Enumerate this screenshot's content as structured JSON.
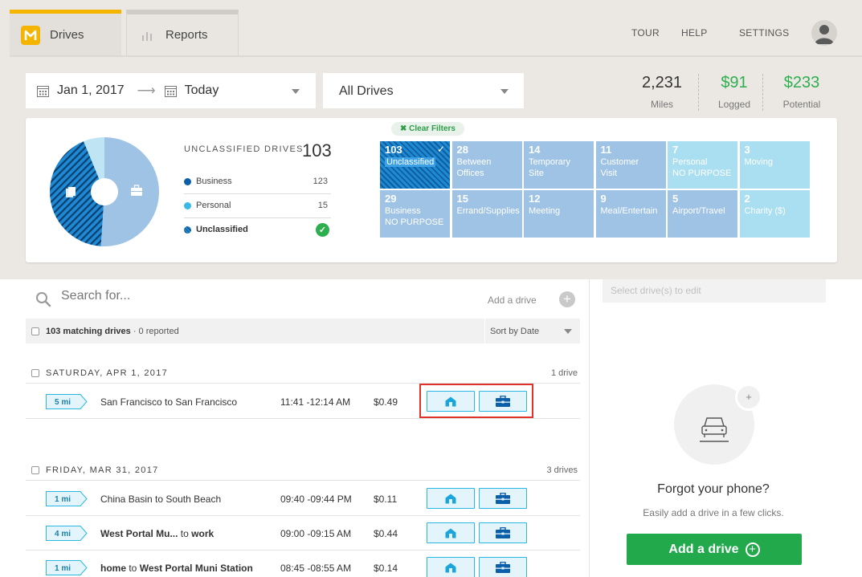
{
  "tabs": {
    "drives": "Drives",
    "reports": "Reports"
  },
  "nav": {
    "tour": "TOUR",
    "help": "HELP",
    "settings": "SETTINGS"
  },
  "filters": {
    "start_date": "Jan 1, 2017",
    "end_date": "Today",
    "drive_filter": "All Drives"
  },
  "stats": {
    "miles": {
      "value": "2,231",
      "label": "Miles"
    },
    "logged": {
      "value": "$91",
      "label": "Logged"
    },
    "potential": {
      "value": "$233",
      "label": "Potential"
    }
  },
  "colors": {
    "accent": "#f5b400",
    "green": "#21a94c",
    "money": "#2dae4f",
    "business": "#0b5ea8",
    "personal": "#38b9e6",
    "tile_business": "#9fc3e4",
    "tile_personal": "#a9dff0"
  },
  "summary": {
    "title": "UNCLASSIFIED DRIVES",
    "count": "103",
    "legend": [
      {
        "label": "Business",
        "count": "123",
        "color": "#0b5ea8"
      },
      {
        "label": "Personal",
        "count": "15",
        "color": "#38b9e6"
      },
      {
        "label": "Unclassified",
        "count": "",
        "color": "#1e89d4"
      }
    ],
    "pie": {
      "business": 123,
      "personal": 15,
      "unclassified": 103
    }
  },
  "clear_filters": "✖ Clear Filters",
  "tiles": [
    {
      "count": "103",
      "line1": "Unclassified",
      "line2": "",
      "kind": "selected"
    },
    {
      "count": "28",
      "line1": "Between",
      "line2": "Offices",
      "kind": "business"
    },
    {
      "count": "14",
      "line1": "Temporary",
      "line2": "Site",
      "kind": "business"
    },
    {
      "count": "11",
      "line1": "Customer",
      "line2": "Visit",
      "kind": "business"
    },
    {
      "count": "7",
      "line1": "Personal",
      "line2": "NO PURPOSE",
      "kind": "personal"
    },
    {
      "count": "3",
      "line1": "Moving",
      "line2": "",
      "kind": "personal"
    },
    {
      "count": "29",
      "line1": "Business",
      "line2": "NO PURPOSE",
      "kind": "business"
    },
    {
      "count": "15",
      "line1": "Errand/Supplies",
      "line2": "",
      "kind": "business"
    },
    {
      "count": "12",
      "line1": "Meeting",
      "line2": "",
      "kind": "business"
    },
    {
      "count": "9",
      "line1": "Meal/Entertain",
      "line2": "",
      "kind": "business"
    },
    {
      "count": "5",
      "line1": "Airport/Travel",
      "line2": "",
      "kind": "business"
    },
    {
      "count": "2",
      "line1": "Charity ($)",
      "line2": "",
      "kind": "personal"
    }
  ],
  "search": {
    "placeholder": "Search for...",
    "add_label": "Add a drive"
  },
  "list_header": {
    "matching": "103 matching drives",
    "reported": " · 0 reported",
    "sort": "Sort by Date"
  },
  "days": [
    {
      "date": "SATURDAY, APR 1, 2017",
      "count": "1 drive",
      "drives": [
        {
          "miles": "5 mi",
          "from": "San Francisco",
          "to": "San Francisco",
          "bold_from": false,
          "bold_to": false,
          "time": "11:41 -12:14 AM",
          "cost": "$0.49"
        }
      ]
    },
    {
      "date": "FRIDAY, MAR 31, 2017",
      "count": "3 drives",
      "drives": [
        {
          "miles": "1 mi",
          "from": "China Basin",
          "to": "South Beach",
          "bold_from": false,
          "bold_to": false,
          "time": "09:40 -09:44 PM",
          "cost": "$0.11"
        },
        {
          "miles": "4 mi",
          "from": "West Portal Mu...",
          "to": "work",
          "bold_from": true,
          "bold_to": true,
          "time": "09:00 -09:15 AM",
          "cost": "$0.44"
        },
        {
          "miles": "1 mi",
          "from": "home",
          "to": "West Portal Muni Station",
          "bold_from": true,
          "bold_to": true,
          "time": "08:45 -08:55 AM",
          "cost": "$0.14"
        }
      ]
    }
  ],
  "right_panel": {
    "edit_placeholder": "Select drive(s) to edit",
    "title": "Forgot your phone?",
    "subtitle": "Easily add a drive in a few clicks.",
    "button": "Add a drive"
  }
}
